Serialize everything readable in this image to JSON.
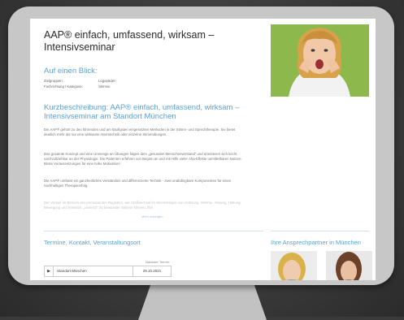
{
  "page": {
    "title": "AAP® einfach, umfassend, wirksam – Intensivseminar"
  },
  "overview": {
    "heading": "Auf einen Blick:",
    "rows": [
      {
        "key": "Zielgruppen:",
        "value": "Logopäden"
      },
      {
        "key": "Fachrichtung / Kategorie:",
        "value": "Stimme"
      }
    ]
  },
  "description": {
    "heading": "Kurzbeschreibung: AAP® einfach, umfassend, wirksam – Intensivseminar am Standort München",
    "paragraphs": [
      "Die AAP® gehört zu den führenden und am häufigsten eingesetzten Methoden in der Stimm- und Sprechtherapie. Sie bietet deutlich mehr als nur eine wirksame Atemtechnik oder einzelne Stimmübungen.",
      "Das gesamte Konzept und eine Unmenge an Übungen folgen dem „gesunden Menschenverstand“ und orientieren sich leicht nachvollziehbar an der Physiologie. Die Patienten erfahren von Beginn an und mit Hilfe vieler Aha-Effekte unmittelbaren Nutzen. Beste Voraussetzungen für eine hohe Motivation!",
      "Die AAP® umfasst ein ganzheitliches Verständnis und differenzierte Technik - zwei unabdingbare Komponenten für einen nachhaltigen Therapieerfolg."
    ],
    "faded": "Der Verlauf im Bereich des permanenten Registers, wie Stoffwechsel im Wechselspiel von Ablösung, Stimme, Atmung, Haltung, Bewegung und Intention, „umsetzt“ Zu bewusster Stimme können, lhre",
    "more_link": "Mehr anzeigen"
  },
  "dates": {
    "heading": "Termine, Kontakt, Veranstaltungsort",
    "column_header": "Nächster Termin:",
    "rows": [
      {
        "location": "Standort München",
        "date": "29.10.2021"
      }
    ]
  },
  "contacts": {
    "heading": "Ihre Ansprechpartner in München"
  },
  "colors": {
    "accent": "#5aa2d8",
    "hero_bg": "#89b64a"
  }
}
